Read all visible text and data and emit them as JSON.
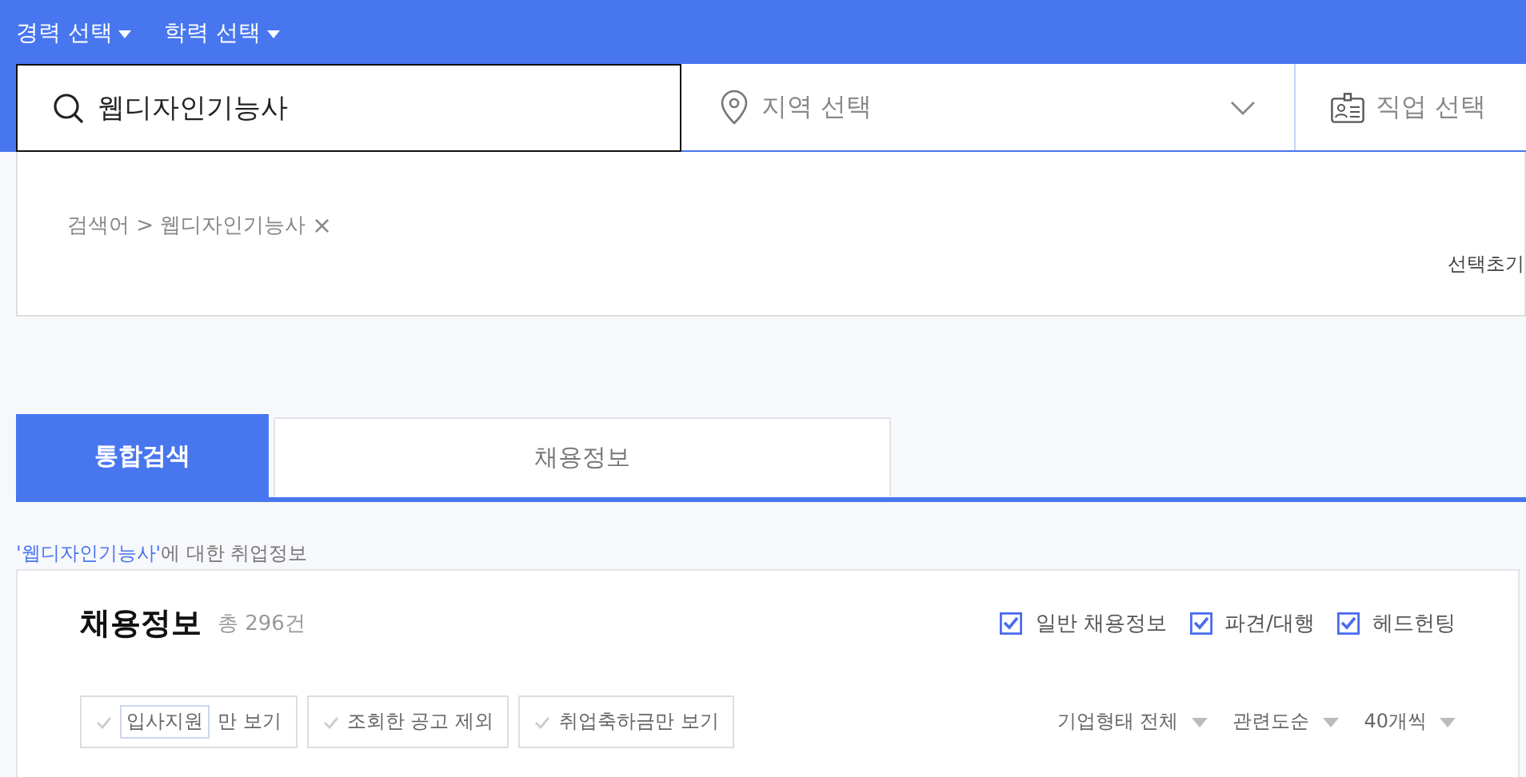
{
  "header_filters": [
    {
      "label": "경력 선택"
    },
    {
      "label": "학력 선택"
    }
  ],
  "search": {
    "value": "웹디자인기능사"
  },
  "region": {
    "placeholder": "지역 선택"
  },
  "job": {
    "placeholder": "직업 선택"
  },
  "breadcrumb": {
    "label": "검색어 >",
    "keyword": "웹디자인기능사",
    "remove": "×"
  },
  "reset": "선택초기",
  "tabs": [
    {
      "label": "통합검색",
      "selected": true
    },
    {
      "label": "채용정보",
      "selected": false
    }
  ],
  "result_note": {
    "keyword": "'웹디자인기능사'",
    "suffix": "에 대한 취업정보"
  },
  "section": {
    "title": "채용정보",
    "count": "총 296건"
  },
  "types": [
    {
      "label": "일반 채용정보",
      "checked": true
    },
    {
      "label": "파견/대행",
      "checked": true
    },
    {
      "label": "헤드헌팅",
      "checked": true
    }
  ],
  "chips": [
    {
      "tag": "입사지원",
      "label": "만 보기",
      "checked": false
    },
    {
      "label": "조회한 공고 제외",
      "checked": false
    },
    {
      "label": "취업축하금만 보기",
      "checked": false
    }
  ],
  "sorts": [
    {
      "label": "기업형태 전체"
    },
    {
      "label": "관련도순"
    },
    {
      "label": "40개씩"
    }
  ]
}
